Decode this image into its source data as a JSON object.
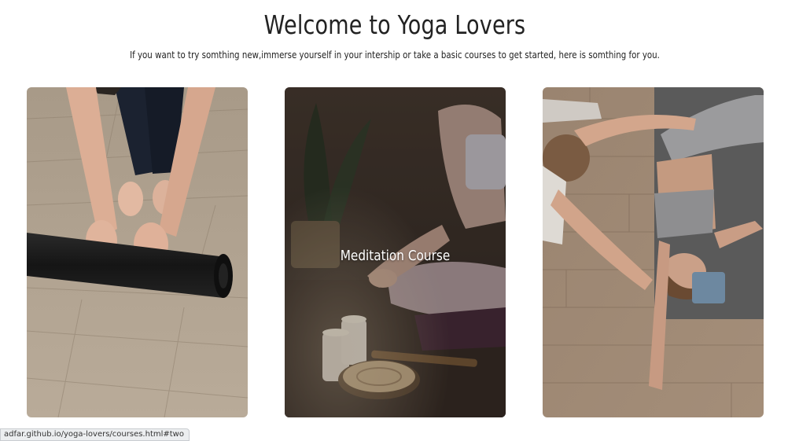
{
  "header": {
    "title": "Welcome to Yoga Lovers",
    "subtitle": "If you want to try somthing new,immerse yourself in your intership or take a basic courses to get started, here is somthing for you."
  },
  "cards": [
    {
      "label": "",
      "image": "rolling-yoga-mat-photo"
    },
    {
      "label": "Meditation Course",
      "image": "meditation-candles-photo"
    },
    {
      "label": "",
      "image": "assisted-stretching-photo"
    }
  ],
  "status_bar": {
    "url": "adfar.github.io/yoga-lovers/courses.html#two"
  },
  "colors": {
    "wood_floor": "#b7a590",
    "mat_black": "#1c1c1c",
    "dark_room": "#3b302a",
    "overlay": "#00000066"
  }
}
